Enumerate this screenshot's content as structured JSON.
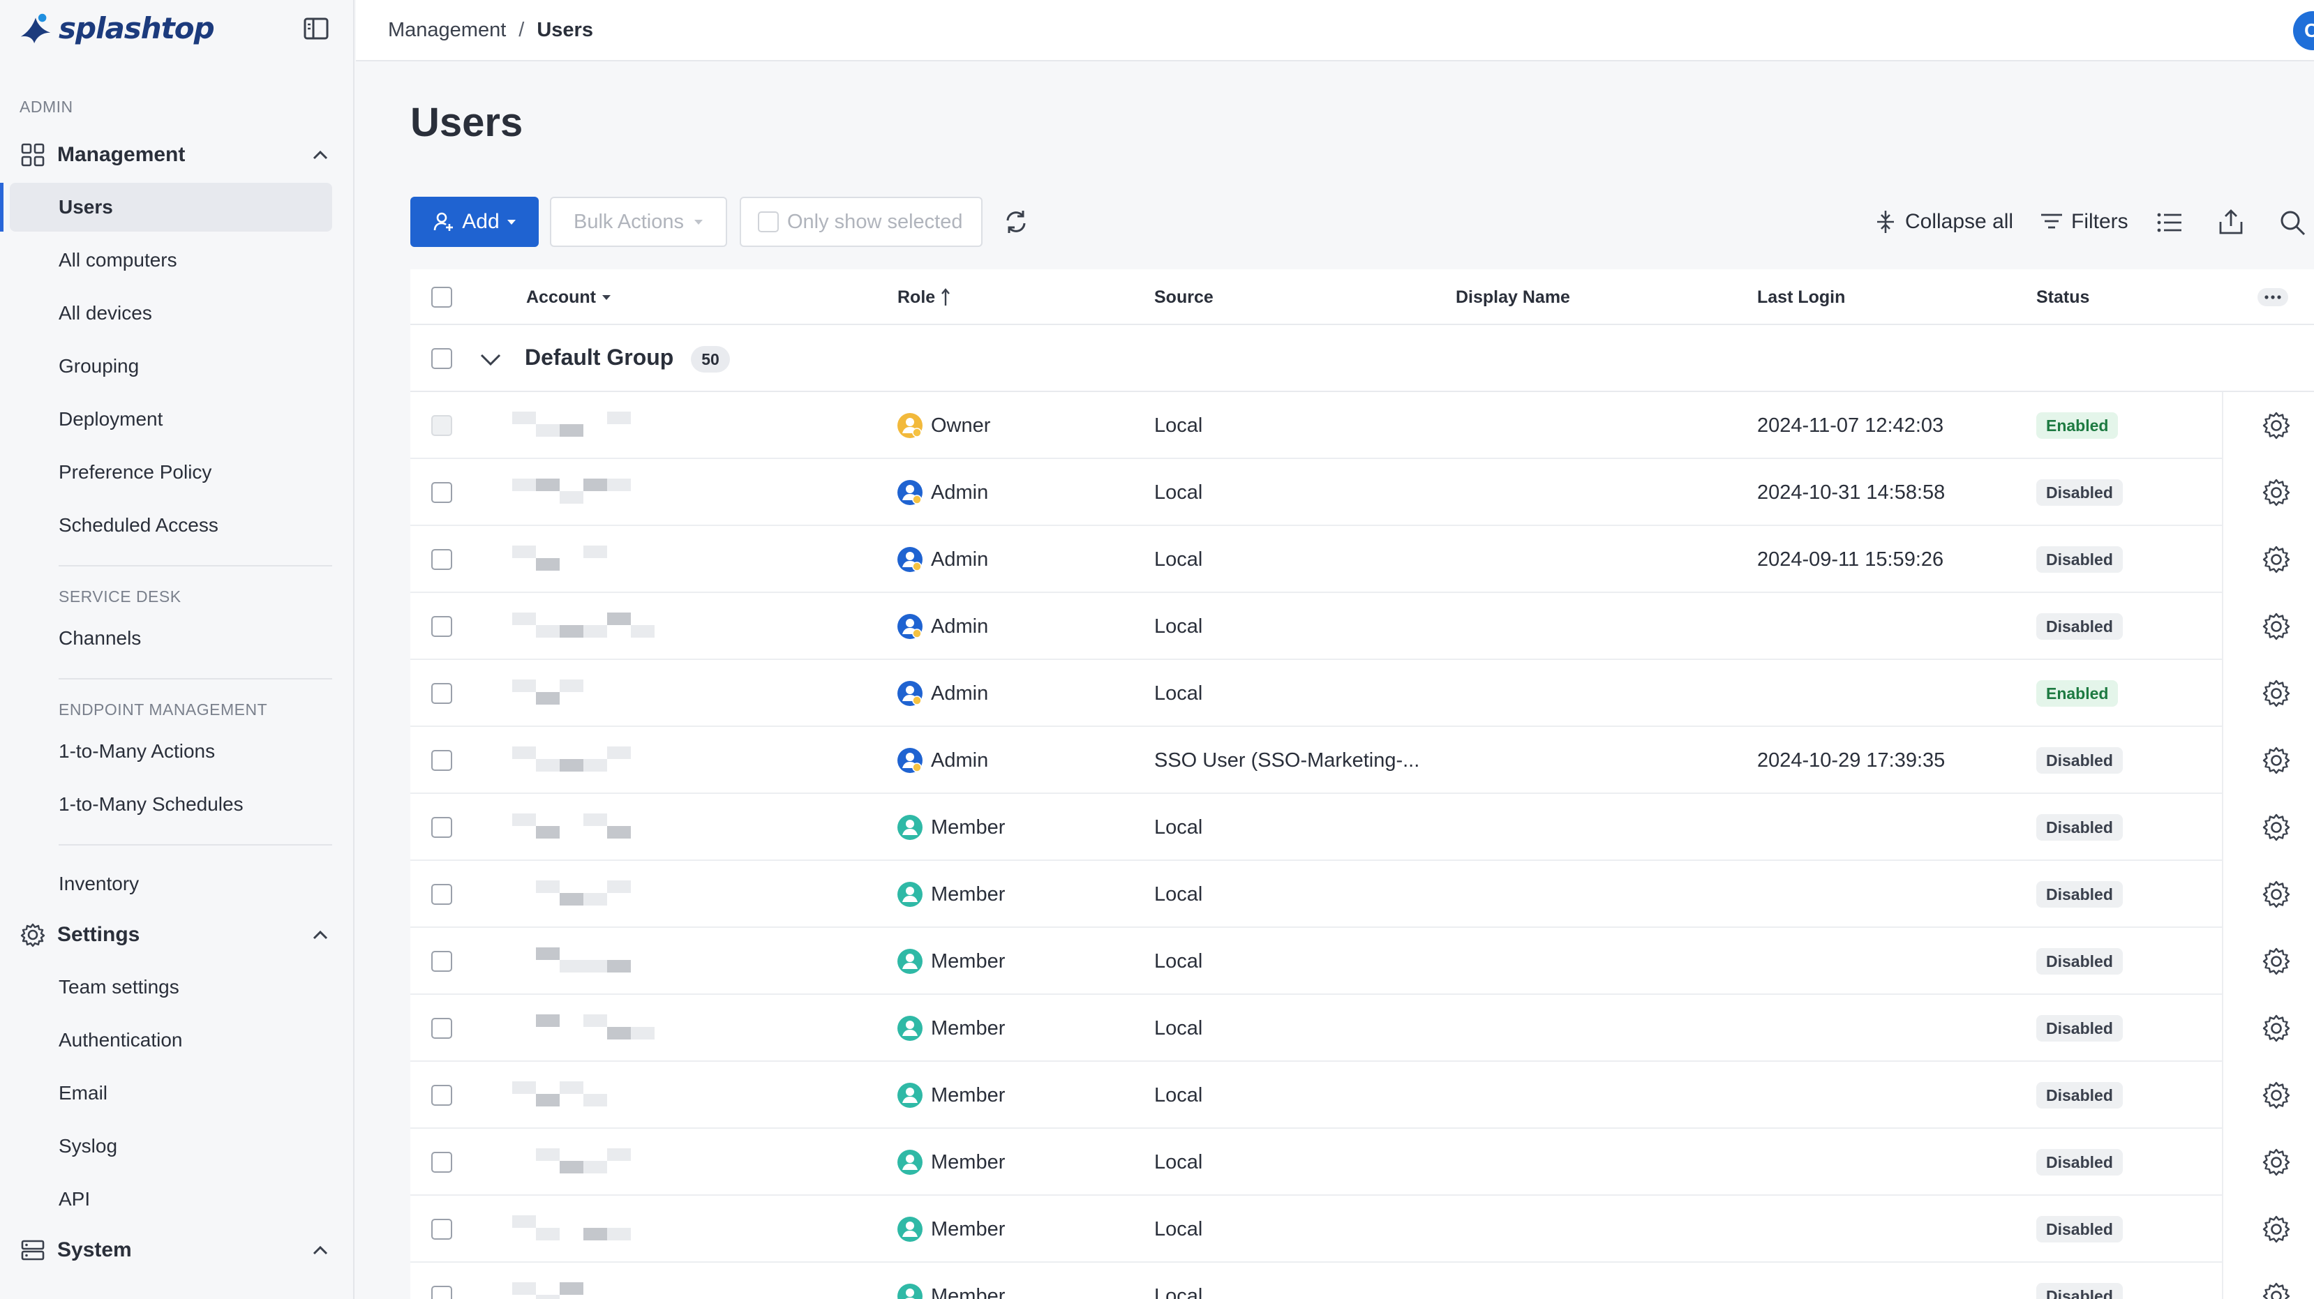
{
  "app": {
    "brand": "splashtop"
  },
  "sidebar": {
    "admin_label": "ADMIN",
    "management": {
      "label": "Management"
    },
    "management_items": [
      "Users",
      "All computers",
      "All devices",
      "Grouping",
      "Deployment",
      "Preference Policy",
      "Scheduled Access"
    ],
    "service_desk_label": "SERVICE DESK",
    "service_desk_items": [
      "Channels"
    ],
    "endpoint_label": "ENDPOINT MANAGEMENT",
    "endpoint_items": [
      "1-to-Many Actions",
      "1-to-Many Schedules"
    ],
    "inventory": "Inventory",
    "settings": {
      "label": "Settings"
    },
    "settings_items": [
      "Team settings",
      "Authentication",
      "Email",
      "Syslog",
      "API"
    ],
    "system": {
      "label": "System"
    }
  },
  "breadcrumb": {
    "parent": "Management",
    "separator": "/",
    "current": "Users"
  },
  "user": {
    "initial": "C"
  },
  "page": {
    "title": "Users"
  },
  "toolbar": {
    "add": "Add",
    "bulk_actions": "Bulk Actions",
    "only_show_selected": "Only show selected",
    "collapse_all": "Collapse all",
    "filters": "Filters"
  },
  "table": {
    "columns": {
      "account": "Account",
      "role": "Role",
      "source": "Source",
      "display_name": "Display Name",
      "last_login": "Last Login",
      "status": "Status"
    },
    "group": {
      "name": "Default Group",
      "count": "50"
    },
    "rows": [
      {
        "role": "Owner",
        "source": "Local",
        "last_login": "2024-11-07 12:42:03",
        "status": "Enabled"
      },
      {
        "role": "Admin",
        "source": "Local",
        "last_login": "2024-10-31 14:58:58",
        "status": "Disabled"
      },
      {
        "role": "Admin",
        "source": "Local",
        "last_login": "2024-09-11 15:59:26",
        "status": "Disabled"
      },
      {
        "role": "Admin",
        "source": "Local",
        "last_login": "",
        "status": "Disabled"
      },
      {
        "role": "Admin",
        "source": "Local",
        "last_login": "",
        "status": "Enabled"
      },
      {
        "role": "Admin",
        "source": "SSO User (SSO-Marketing-...",
        "last_login": "2024-10-29 17:39:35",
        "status": "Disabled"
      },
      {
        "role": "Member",
        "source": "Local",
        "last_login": "",
        "status": "Disabled"
      },
      {
        "role": "Member",
        "source": "Local",
        "last_login": "",
        "status": "Disabled"
      },
      {
        "role": "Member",
        "source": "Local",
        "last_login": "",
        "status": "Disabled"
      },
      {
        "role": "Member",
        "source": "Local",
        "last_login": "",
        "status": "Disabled"
      },
      {
        "role": "Member",
        "source": "Local",
        "last_login": "",
        "status": "Disabled"
      },
      {
        "role": "Member",
        "source": "Local",
        "last_login": "",
        "status": "Disabled"
      },
      {
        "role": "Member",
        "source": "Local",
        "last_login": "",
        "status": "Disabled"
      },
      {
        "role": "Member",
        "source": "Local",
        "last_login": "",
        "status": "Disabled"
      }
    ]
  },
  "colors": {
    "accent": "#1f63d1",
    "enabled_bg": "#e4f5ea",
    "enabled_fg": "#1d7a41",
    "owner": "#f2b93b",
    "admin": "#1f63d1",
    "member": "#2fb9a6"
  }
}
